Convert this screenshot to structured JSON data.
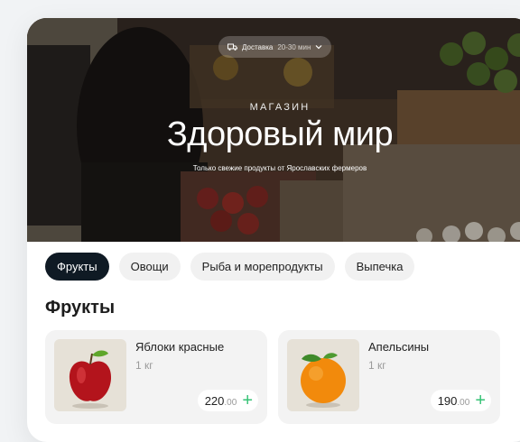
{
  "hero": {
    "delivery_label": "Доставка",
    "delivery_time": "20-30 мин",
    "subtitle": "МАГАЗИН",
    "title": "Здоровый мир",
    "tagline": "Только свежие продукты от Ярославских фермеров"
  },
  "tabs": [
    {
      "label": "Фрукты",
      "active": true
    },
    {
      "label": "Овощи",
      "active": false
    },
    {
      "label": "Рыба и морепродукты",
      "active": false
    },
    {
      "label": "Выпечка",
      "active": false
    }
  ],
  "section_title": "Фрукты",
  "products": [
    {
      "name": "Яблоки красные",
      "unit": "1 кг",
      "price": "220",
      "price_decimal": ".00",
      "image_icon": "apple-icon"
    },
    {
      "name": "Апельсины",
      "unit": "1 кг",
      "price": "190",
      "price_decimal": ".00",
      "image_icon": "orange-icon"
    }
  ],
  "colors": {
    "active_tab": "#0f1a24",
    "add_accent": "#35c275"
  }
}
